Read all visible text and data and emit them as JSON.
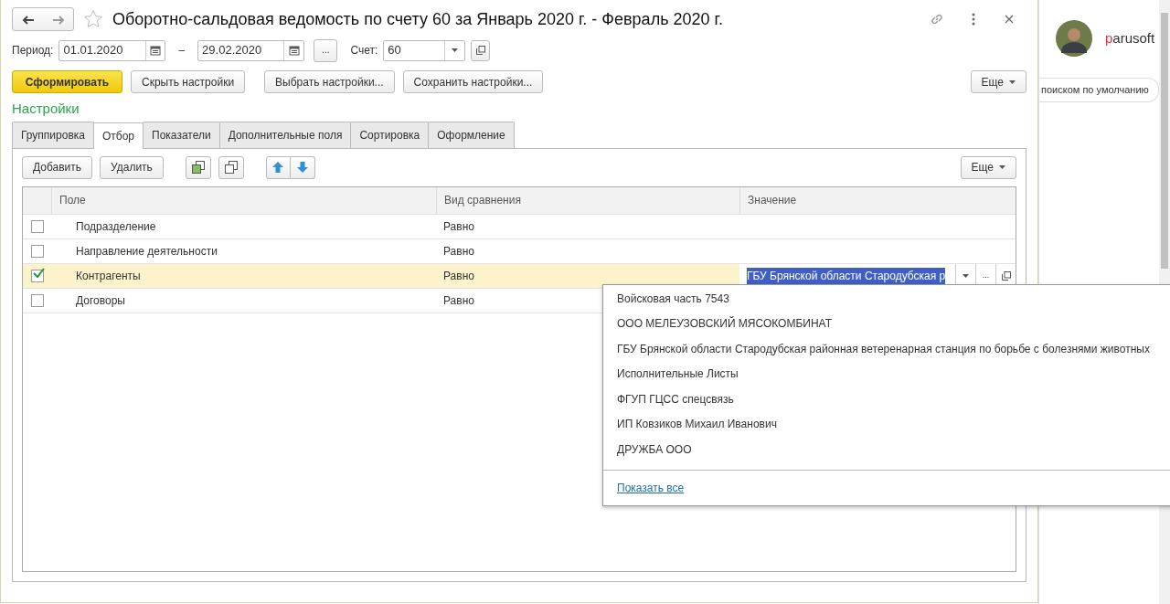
{
  "window": {
    "title": "Оборотно-сальдовая ведомость по счету 60 за Январь 2020 г. - Февраль 2020 г.",
    "favorite": false
  },
  "period": {
    "label": "Период:",
    "from": "01.01.2020",
    "separator": "–",
    "to": "29.02.2020",
    "more_button": "..."
  },
  "account": {
    "label": "Счет:",
    "value": "60"
  },
  "actions": [
    {
      "label": "Сформировать",
      "kind": "primary"
    },
    {
      "label": "Скрыть настройки",
      "kind": "normal"
    },
    {
      "label": "Выбрать настройки...",
      "kind": "normal"
    },
    {
      "label": "Сохранить настройки...",
      "kind": "normal"
    }
  ],
  "more_button": "Еще",
  "settings_title": "Настройки",
  "tabs": [
    {
      "label": "Группировка",
      "selected": false
    },
    {
      "label": "Отбор",
      "selected": true
    },
    {
      "label": "Показатели",
      "selected": false
    },
    {
      "label": "Дополнительные поля",
      "selected": false
    },
    {
      "label": "Сортировка",
      "selected": false
    },
    {
      "label": "Оформление",
      "selected": false
    }
  ],
  "filter_toolbar": {
    "add": "Добавить",
    "remove": "Удалить",
    "more": "Еще"
  },
  "table": {
    "columns": [
      "Поле",
      "Вид сравнения",
      "Значение"
    ],
    "rows": [
      {
        "checked": false,
        "selected": false,
        "field": "Подразделение",
        "comparison": "Равно"
      },
      {
        "checked": false,
        "selected": false,
        "field": "Направление деятельности",
        "comparison": "Равно"
      },
      {
        "checked": true,
        "selected": true,
        "field": "Контрагенты",
        "comparison": "Равно",
        "value": "ГБУ Брянской области Стародубская р",
        "value_select_button": "..."
      },
      {
        "checked": false,
        "selected": false,
        "field": "Договоры",
        "comparison": "Равно"
      }
    ]
  },
  "dropdown": {
    "items": [
      "Войсковая часть 7543",
      "ООО МЕЛЕУЗОВСКИЙ МЯСОКОМБИНАТ",
      "ГБУ Брянской области Стародубская районная ветеренарная станция по борьбе с болезнями животных",
      "Исполнительные Листы",
      "ФГУП ГЦСС спецсвязь",
      "ИП Ковзиков Михаил Иванович",
      "ДРУЖБА ООО"
    ],
    "show_all": "Показать все"
  },
  "background_page": {
    "user": "parusoft",
    "search_hint": "поиском по умолчанию"
  }
}
